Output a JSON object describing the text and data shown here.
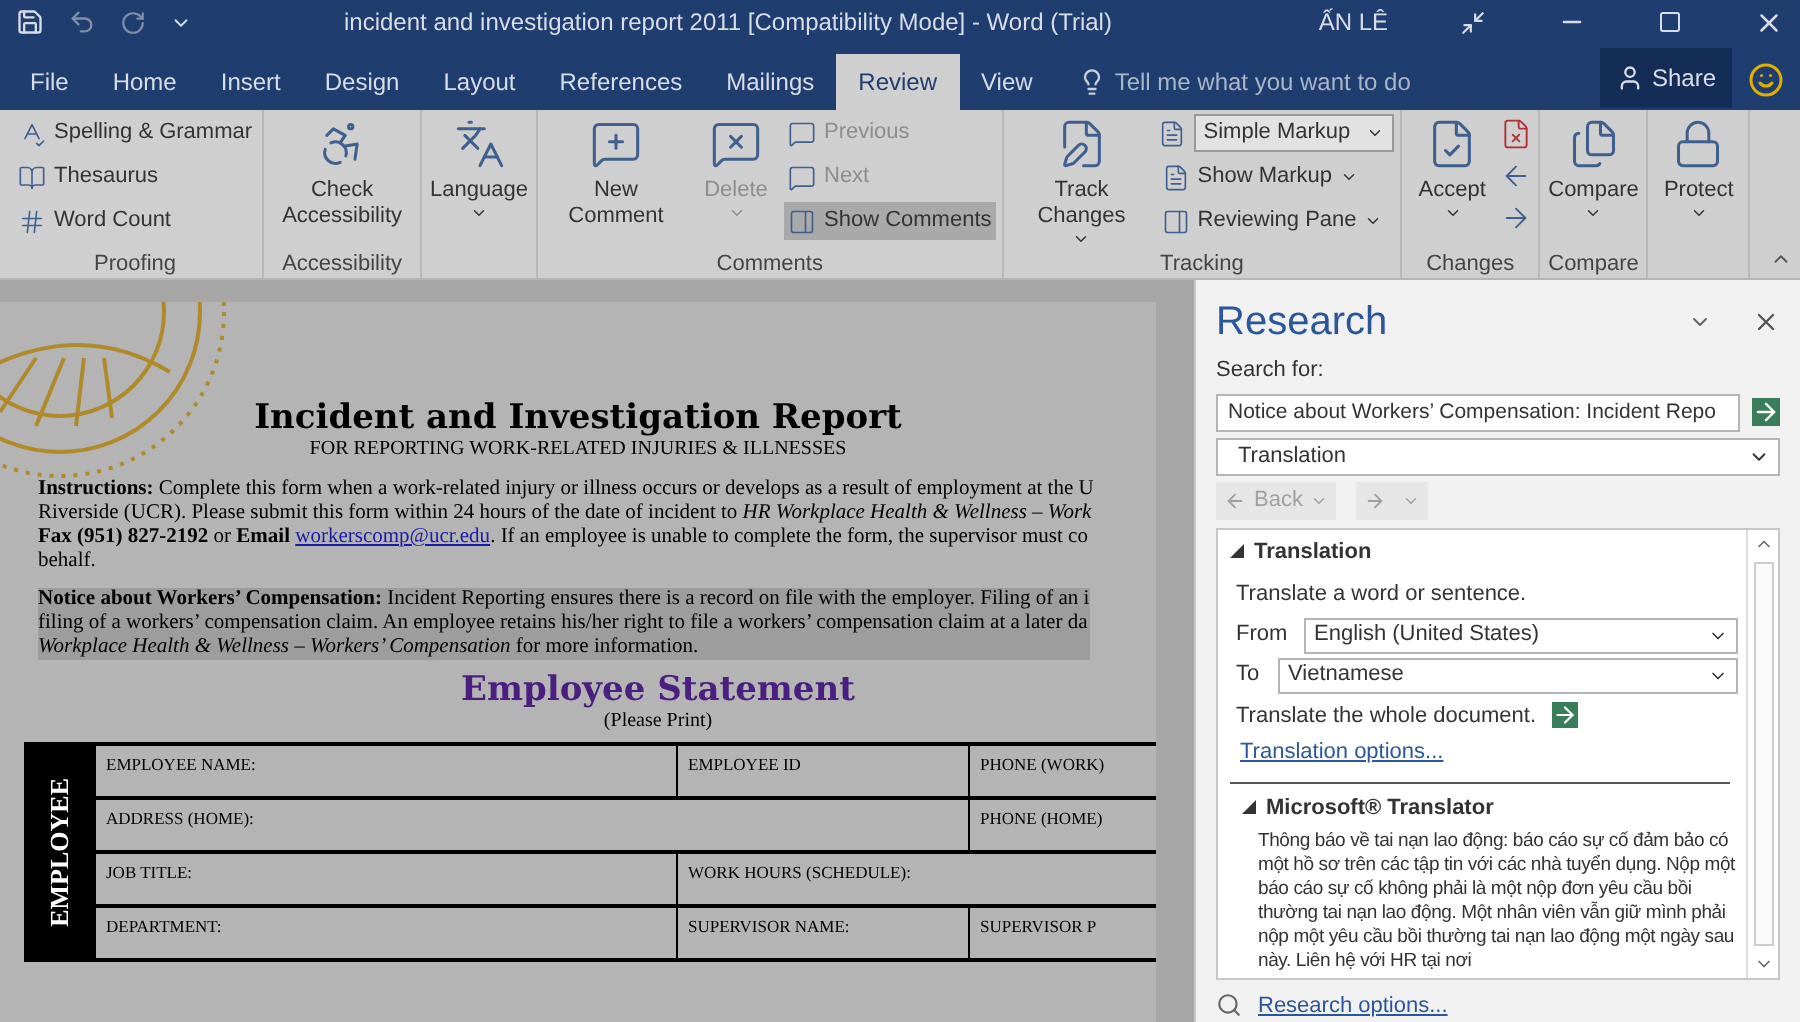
{
  "title_bar": {
    "title": "incident and investigation report 2011 [Compatibility Mode]  -  Word (Trial)",
    "user": "ẤN LÊ"
  },
  "tabs": [
    {
      "label": "File",
      "selected": false
    },
    {
      "label": "Home",
      "selected": false
    },
    {
      "label": "Insert",
      "selected": false
    },
    {
      "label": "Design",
      "selected": false
    },
    {
      "label": "Layout",
      "selected": false
    },
    {
      "label": "References",
      "selected": false
    },
    {
      "label": "Mailings",
      "selected": false
    },
    {
      "label": "Review",
      "selected": true
    },
    {
      "label": "View",
      "selected": false
    }
  ],
  "tell_me": {
    "placeholder": "Tell me what you want to do"
  },
  "share": "Share",
  "ribbon": [
    {
      "label": "Proofing",
      "columns": [
        {
          "kind": "stack",
          "items": [
            {
              "label": "Spelling & Grammar",
              "disabled": false,
              "selected": false
            },
            {
              "label": "Thesaurus",
              "disabled": false,
              "selected": false
            },
            {
              "label": "Word Count",
              "disabled": false,
              "selected": false
            }
          ]
        }
      ]
    },
    {
      "label": "Accessibility",
      "columns": [
        {
          "kind": "large",
          "label": "Check Accessibility",
          "disabled": false,
          "dropdown": false
        }
      ]
    },
    {
      "columns": [
        {
          "kind": "large",
          "label": "Language",
          "disabled": false,
          "dropdown": true
        }
      ]
    },
    {
      "label": "Comments",
      "columns": [
        {
          "kind": "large",
          "label": "New Comment",
          "disabled": false,
          "dropdown": false
        },
        {
          "kind": "large",
          "label": "Delete",
          "disabled": true,
          "dropdown": true
        },
        {
          "kind": "stack",
          "items": [
            {
              "label": "Previous",
              "disabled": true,
              "selected": false
            },
            {
              "label": "Next",
              "disabled": true,
              "selected": false
            },
            {
              "label": "Show Comments",
              "disabled": false,
              "selected": true
            }
          ]
        }
      ]
    },
    {
      "label": "Tracking",
      "columns": [
        {
          "kind": "large",
          "label": "Track Changes",
          "disabled": false,
          "dropdown": true
        },
        {
          "kind": "stack",
          "items": [
            {
              "label": "Simple Markup",
              "disabled": false,
              "selected": false,
              "kind": "combo"
            },
            {
              "label": "Show Markup",
              "disabled": false,
              "selected": false,
              "kind": "menu"
            },
            {
              "label": "Reviewing Pane",
              "disabled": false,
              "selected": false,
              "kind": "menu"
            }
          ]
        }
      ]
    },
    {
      "label": "Changes",
      "columns": [
        {
          "kind": "large",
          "label": "Accept",
          "disabled": false,
          "dropdown": true
        },
        {
          "kind": "icons"
        }
      ]
    },
    {
      "label": "Compare",
      "columns": [
        {
          "kind": "large",
          "label": "Compare",
          "disabled": false,
          "dropdown": true
        }
      ]
    },
    {
      "columns": [
        {
          "kind": "large",
          "label": "Protect",
          "disabled": false,
          "dropdown": true
        }
      ]
    }
  ],
  "document": {
    "title": "Incident and Investigation Report",
    "subtitle": "FOR REPORTING WORK-RELATED INJURIES & ILLNESSES",
    "instructions": [
      {
        "text": "**Instructions:** Complete this form when a work-related injury or illness occurs or develops as a result of employment at the U"
      },
      {
        "text": "Riverside (UCR). Please submit this form within 24 hours of the date of incident to *HR Workplace Health & Wellness – Work*"
      },
      {
        "text": "**Fax (951) 827-2192** or **Email** ",
        "link": "workerscomp@ucr.edu",
        "after": ". If an employee is unable to complete the form, the supervisor must co"
      },
      {
        "text": "behalf."
      }
    ],
    "notice": [
      "**Notice about Workers’ Compensation:** Incident Reporting ensures there is a record on file with the employer.  Filing of an i",
      "filing of a workers’ compensation claim.  An employee retains his/her right to file a workers’ compensation claim at a later da",
      "*Workplace Health & Wellness – Workers’ Compensation* for more information."
    ],
    "section_title": "Employee Statement",
    "section_note": "(Please Print)",
    "side_label": "EMPLOYEE",
    "rows": [
      [
        "EMPLOYEE NAME:",
        "EMPLOYEE ID",
        "PHONE (WORK)"
      ],
      [
        "ADDRESS (HOME):",
        "",
        "PHONE (HOME)"
      ],
      [
        "JOB TITLE:",
        "WORK HOURS (SCHEDULE):",
        ""
      ],
      [
        "DEPARTMENT:",
        "SUPERVISOR NAME:",
        "SUPERVISOR P"
      ]
    ]
  },
  "research": {
    "title": "Research",
    "search_label": "Search for:",
    "search_value": "Notice about Workers’ Compensation: Incident Repo",
    "service": "Translation",
    "back": "Back",
    "section": "Translation",
    "hint": "Translate a word or sentence.",
    "from_label": "From",
    "from_value": "English (United States)",
    "to_label": "To",
    "to_value": "Vietnamese",
    "whole_doc": "Translate the whole document.",
    "options_link": "Translation options...",
    "translator_title": "Microsoft® Translator",
    "translation": "Thông báo về tai nạn lao động: báo cáo sự cố đảm bảo có một hồ sơ trên các tập tin với các nhà tuyển dụng.  Nộp một báo cáo sự cố không phải là một nộp đơn yêu cầu bồi thường tai nạn lao động.  Một nhân viên vẫn giữ mình phải nộp một yêu cầu bồi thường tai nạn lao động một ngày sau này.  Liên hệ với HR tại nơi",
    "footer_link": "Research options..."
  }
}
